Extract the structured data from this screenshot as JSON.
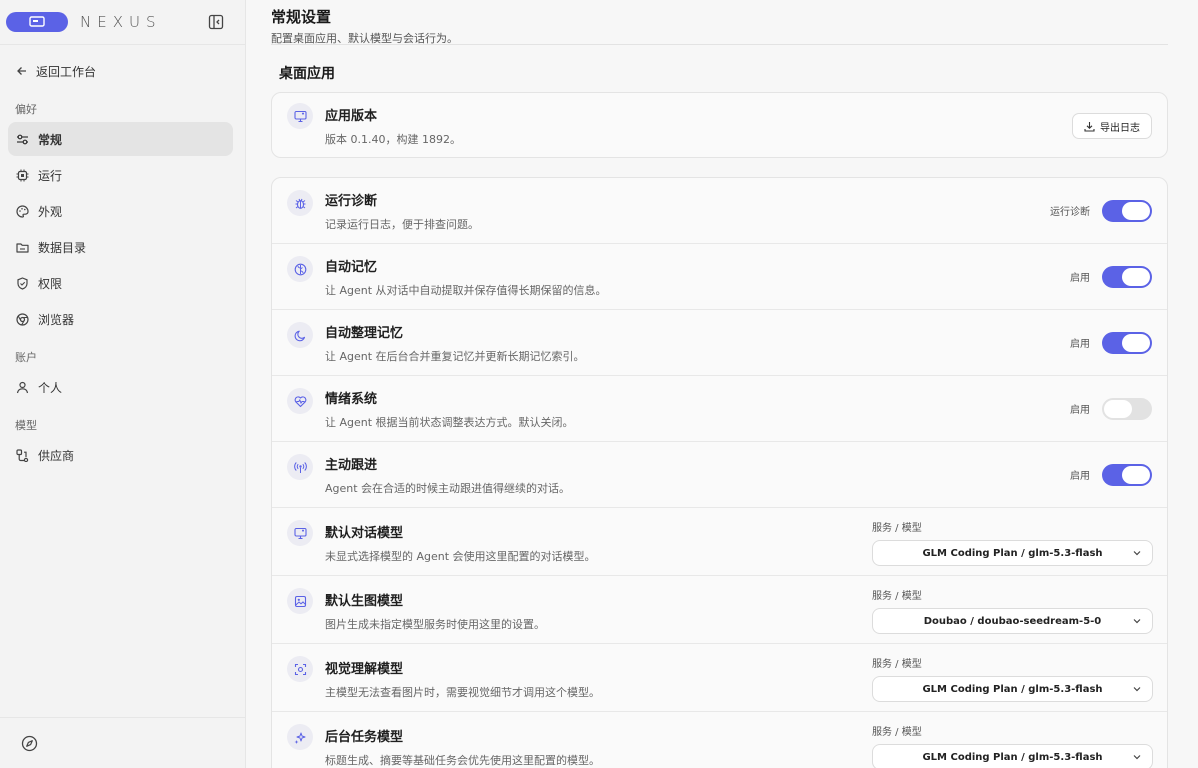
{
  "brand": "NEXUS",
  "accent": "#5b62e6",
  "sidebar": {
    "back_label": "返回工作台",
    "groups": [
      {
        "label": "偏好",
        "items": [
          {
            "label": "常规",
            "icon": "sliders-icon",
            "active": true
          },
          {
            "label": "运行",
            "icon": "cpu-icon"
          },
          {
            "label": "外观",
            "icon": "palette-icon"
          },
          {
            "label": "数据目录",
            "icon": "folder-icon"
          },
          {
            "label": "权限",
            "icon": "shield-icon"
          },
          {
            "label": "浏览器",
            "icon": "chrome-icon"
          }
        ]
      },
      {
        "label": "账户",
        "items": [
          {
            "label": "个人",
            "icon": "user-icon"
          }
        ]
      },
      {
        "label": "模型",
        "items": [
          {
            "label": "供应商",
            "icon": "provider-icon"
          }
        ]
      }
    ]
  },
  "page": {
    "title": "常规设置",
    "subtitle": "配置桌面应用、默认模型与会话行为。",
    "section_title": "桌面应用"
  },
  "app_version": {
    "title": "应用版本",
    "desc": "版本 0.1.40，构建 1892。",
    "export_label": "导出日志"
  },
  "settings": [
    {
      "title": "运行诊断",
      "desc": "记录运行日志，便于排查问题。",
      "toggle_label": "运行诊断",
      "on": true
    },
    {
      "title": "自动记忆",
      "desc": "让 Agent 从对话中自动提取并保存值得长期保留的信息。",
      "toggle_label": "启用",
      "on": true
    },
    {
      "title": "自动整理记忆",
      "desc": "让 Agent 在后台合并重复记忆并更新长期记忆索引。",
      "toggle_label": "启用",
      "on": true
    },
    {
      "title": "情绪系统",
      "desc": "让 Agent 根据当前状态调整表达方式。默认关闭。",
      "toggle_label": "启用",
      "on": false
    },
    {
      "title": "主动跟进",
      "desc": "Agent 会在合适的时候主动跟进值得继续的对话。",
      "toggle_label": "启用",
      "on": true
    }
  ],
  "models": [
    {
      "title": "默认对话模型",
      "desc": "未显式选择模型的 Agent 会使用这里配置的对话模型。",
      "label": "服务 / 模型",
      "value": "GLM Coding Plan / glm-5.3-flash"
    },
    {
      "title": "默认生图模型",
      "desc": "图片生成未指定模型服务时使用这里的设置。",
      "label": "服务 / 模型",
      "value": "Doubao / doubao-seedream-5-0"
    },
    {
      "title": "视觉理解模型",
      "desc": "主模型无法查看图片时，需要视觉细节才调用这个模型。",
      "label": "服务 / 模型",
      "value": "GLM Coding Plan / glm-5.3-flash"
    },
    {
      "title": "后台任务模型",
      "desc": "标题生成、摘要等基础任务会优先使用这里配置的模型。",
      "label": "服务 / 模型",
      "value": "GLM Coding Plan / glm-5.3-flash"
    }
  ]
}
